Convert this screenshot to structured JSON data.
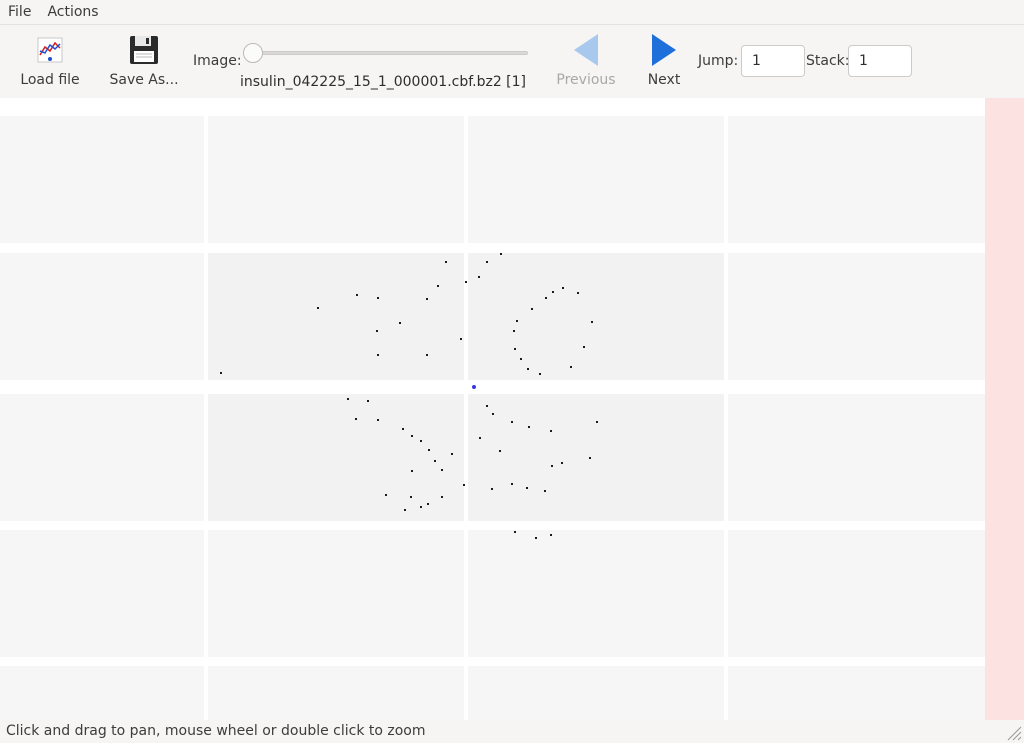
{
  "menu": {
    "file": "File",
    "actions": "Actions"
  },
  "toolbar": {
    "load_file": "Load file",
    "save_as": "Save As...",
    "image_label": "Image:",
    "image_slider_position": 0,
    "filename": "insulin_042225_15_1_000001.cbf.bz2 [1]",
    "previous": "Previous",
    "next": "Next",
    "jump_label": "Jump:",
    "jump_value": "1",
    "stack_label": "Stack:",
    "stack_value": "1"
  },
  "icons": {
    "load_file": "chart-load-icon",
    "save_as": "floppy-disk-icon",
    "previous": "arrow-left-icon",
    "next": "arrow-right-icon"
  },
  "colors": {
    "arrow_active": "#1e6fd9",
    "arrow_disabled": "#a9c8ee",
    "side_strip": "#fde2e2",
    "beam_center": "#3a3adf"
  },
  "status": {
    "hint": "Click and drag to pan, mouse wheel or double click to zoom"
  }
}
